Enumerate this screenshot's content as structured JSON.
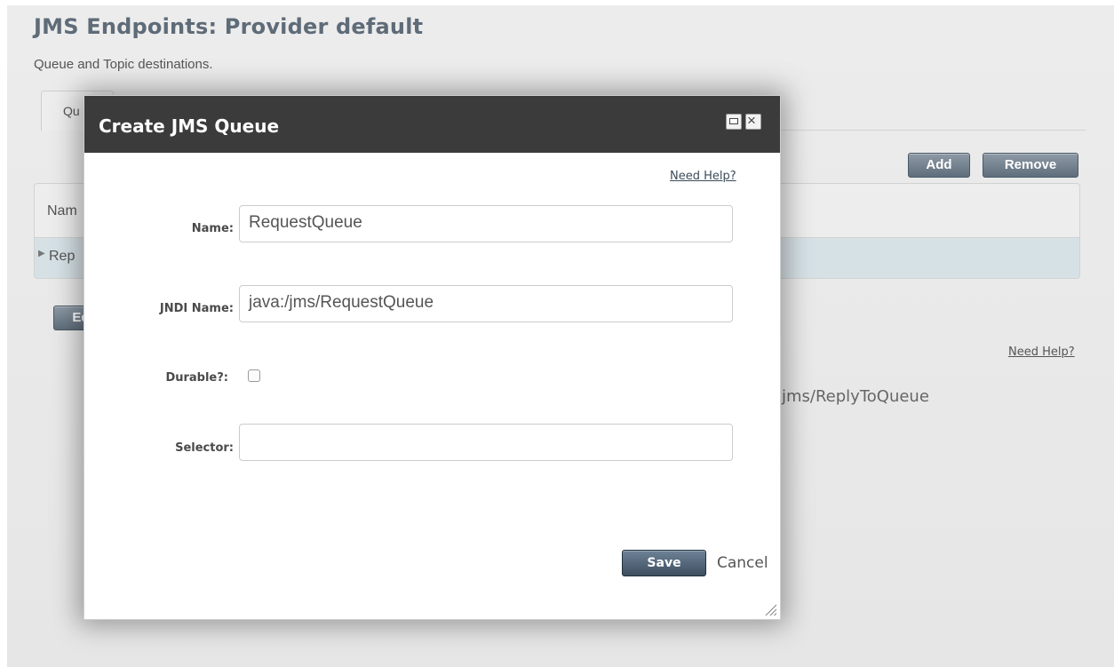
{
  "page": {
    "title": "JMS Endpoints: Provider default",
    "subtitle": "Queue and Topic destinations.",
    "tab_label": "Qu",
    "add_label": "Add",
    "remove_label": "Remove",
    "table_header": "Nam",
    "table_row": "Rep",
    "edit_label": "Ed",
    "help_link": "Need Help?",
    "jndi_text": "jms/ReplyToQueue"
  },
  "dialog": {
    "title": "Create JMS Queue",
    "help_link": "Need Help?",
    "fields": {
      "name": {
        "label": "Name:",
        "value": "RequestQueue"
      },
      "jndi": {
        "label": "JNDI Name:",
        "value": "java:/jms/RequestQueue"
      },
      "durable": {
        "label": "Durable?:",
        "checked": false
      },
      "selector": {
        "label": "Selector:",
        "value": ""
      }
    },
    "save_label": "Save",
    "cancel_label": "Cancel"
  }
}
